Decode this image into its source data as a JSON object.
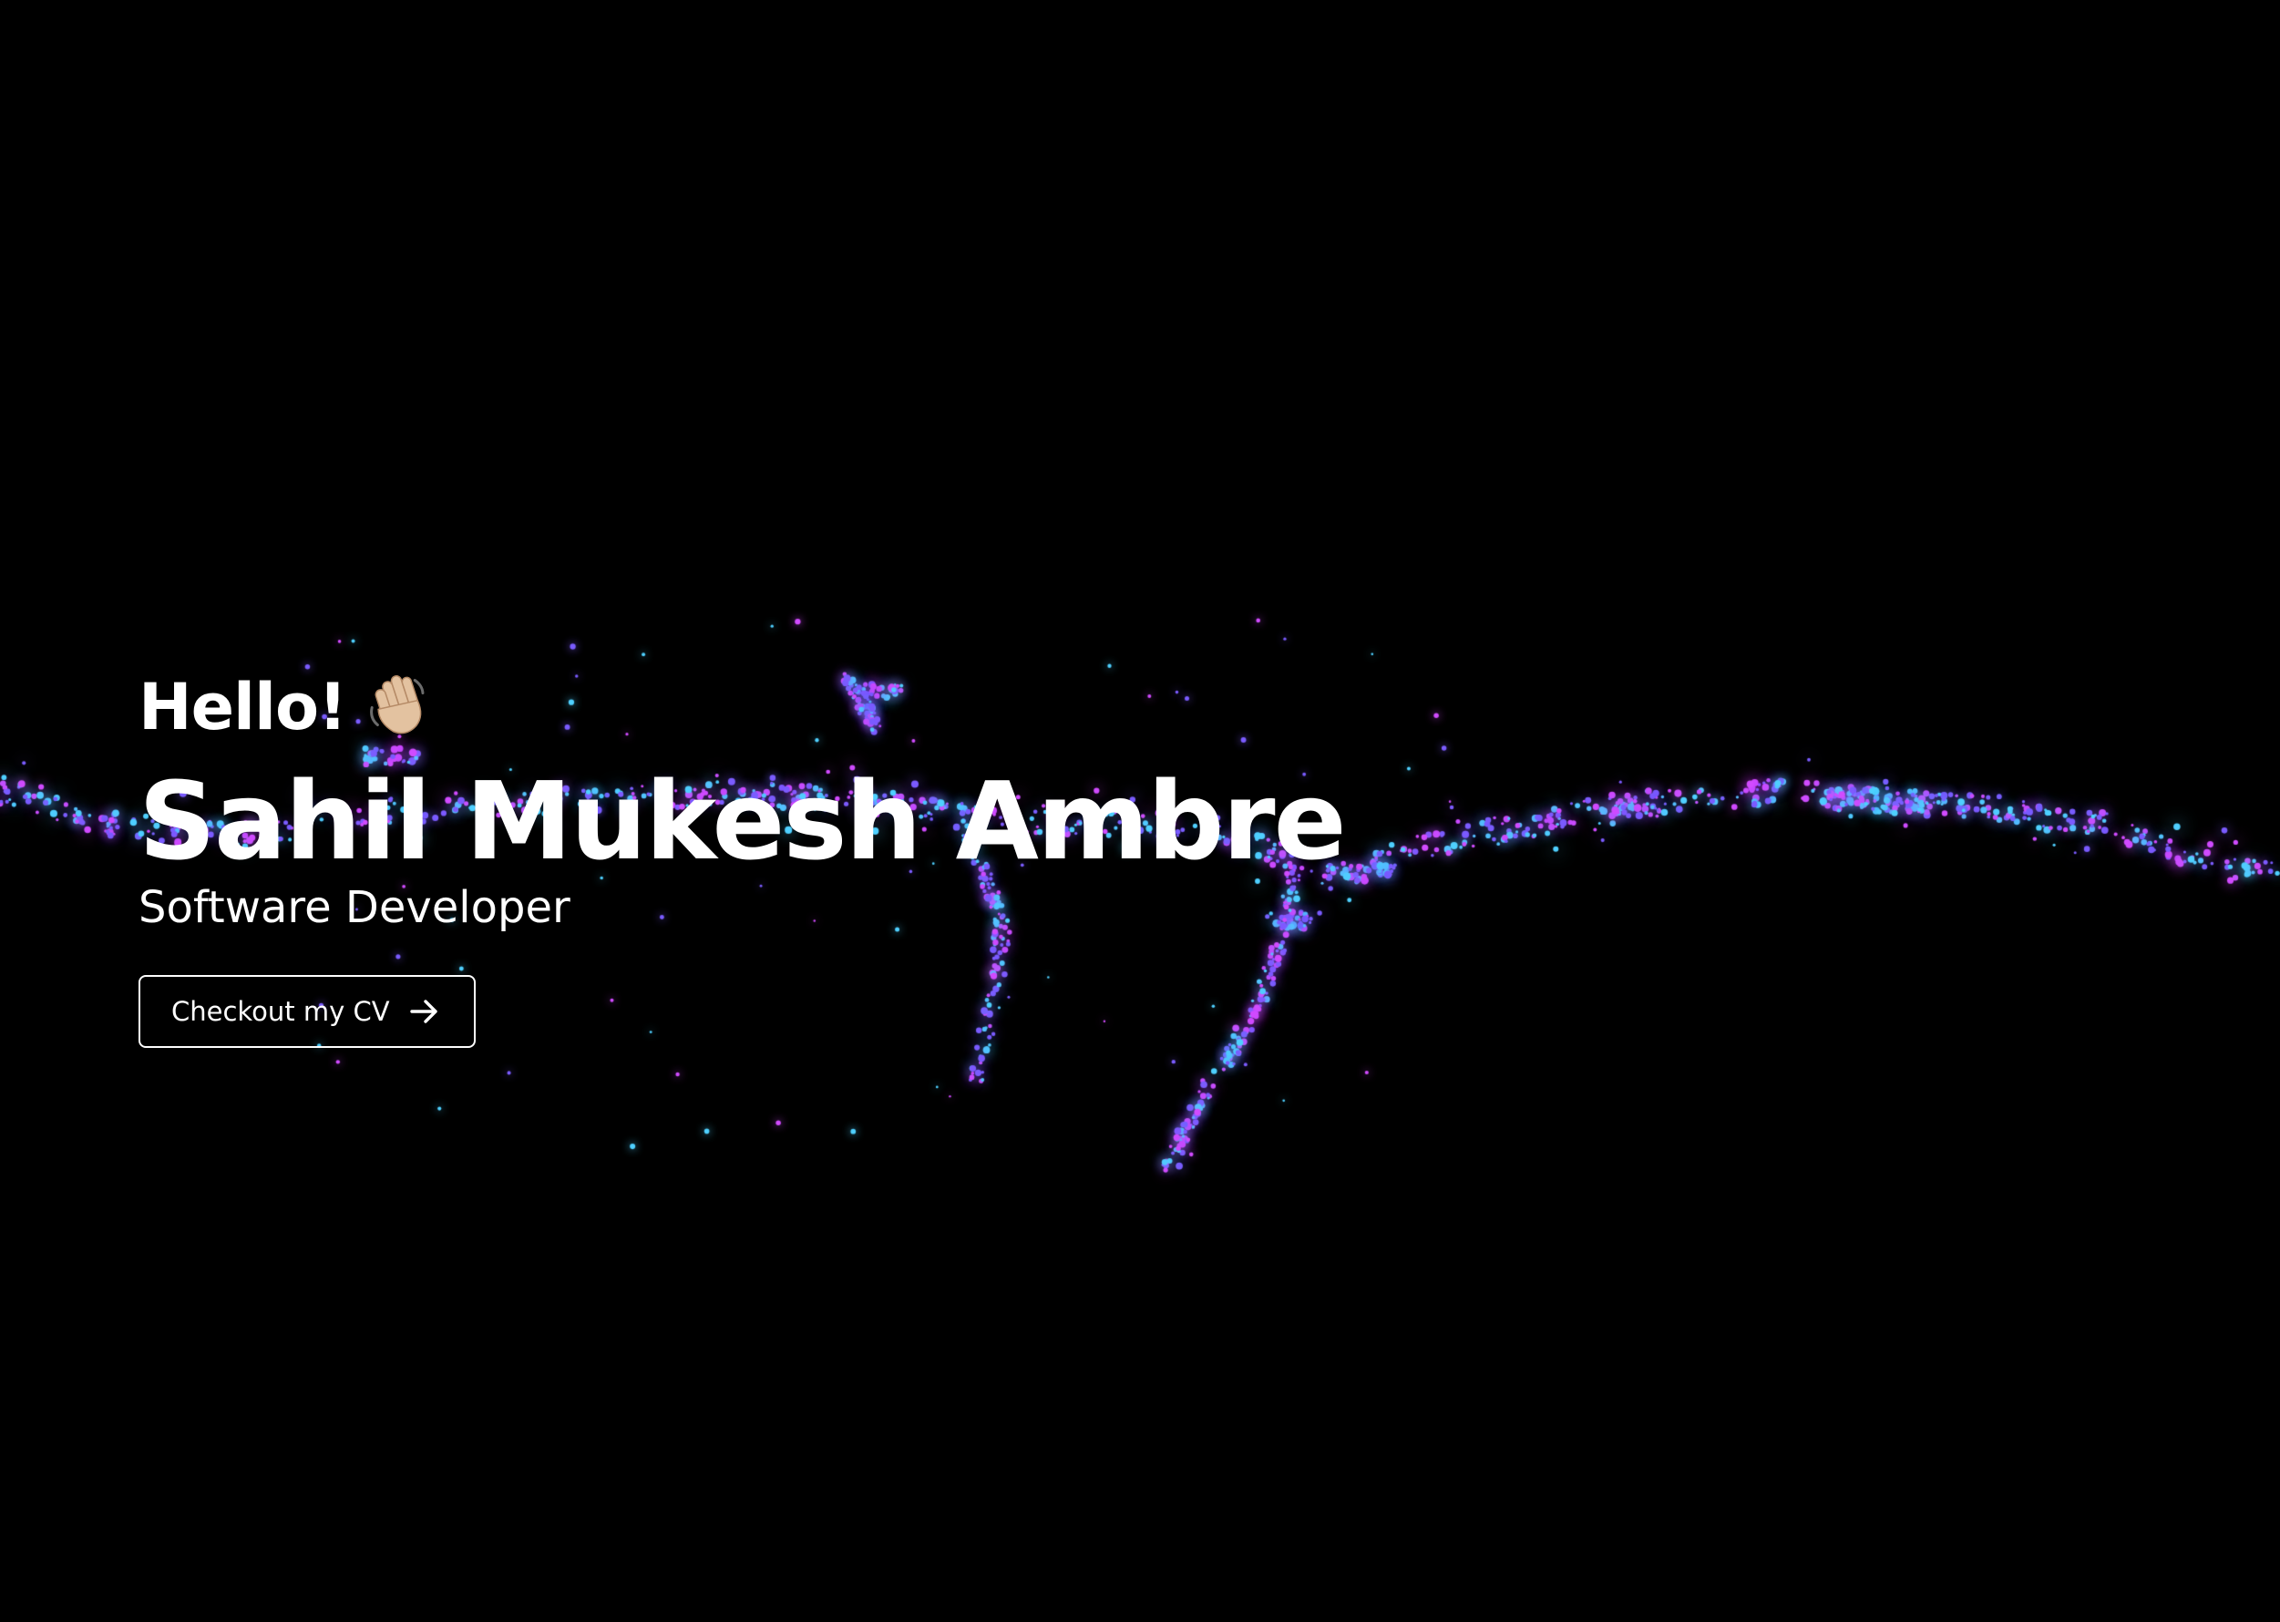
{
  "hero": {
    "greeting": "Hello!",
    "name": "Sahil Mukesh Ambre",
    "role": "Software Developer",
    "cta_label": "Checkout my CV"
  },
  "icons": {
    "greeting_icon": "waving-hand-icon",
    "cta_icon": "arrow-right-icon"
  },
  "colors": {
    "background": "#000000",
    "text": "#ffffff",
    "particle_magenta": "#d14bff",
    "particle_violet": "#7b5cff",
    "particle_cyan": "#4fd0ff"
  }
}
